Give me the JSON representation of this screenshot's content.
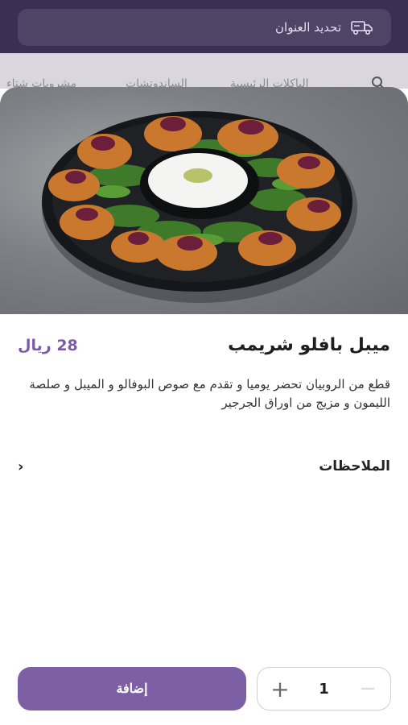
{
  "header": {
    "address_label": "تحديد العنوان",
    "address_icon": "delivery-truck-icon"
  },
  "categories": {
    "items": [
      "مشروبات شتاء",
      "الساندوتشات",
      "الباكلات الرئيسية"
    ],
    "search_icon": "search-icon"
  },
  "product": {
    "title": "ميبل بافلو شريمب",
    "price": "28 ريال",
    "description": "قطع من الروبيان تحضر يوميا و تقدم مع صوص البوفالو و الميبل و صلصة الليمون و مزيج من اوراق الجرجير",
    "image_icon": "food-photo"
  },
  "notes": {
    "label": "الملاحظات",
    "chevron_icon": "chevron-right-icon"
  },
  "cart": {
    "add_label": "إضافة",
    "quantity": "1",
    "plus_icon": "plus-icon",
    "minus_icon": "minus-icon"
  },
  "colors": {
    "header_bg": "#3b2f55",
    "accent": "#7c5fa5",
    "price": "#7a5ba8"
  }
}
